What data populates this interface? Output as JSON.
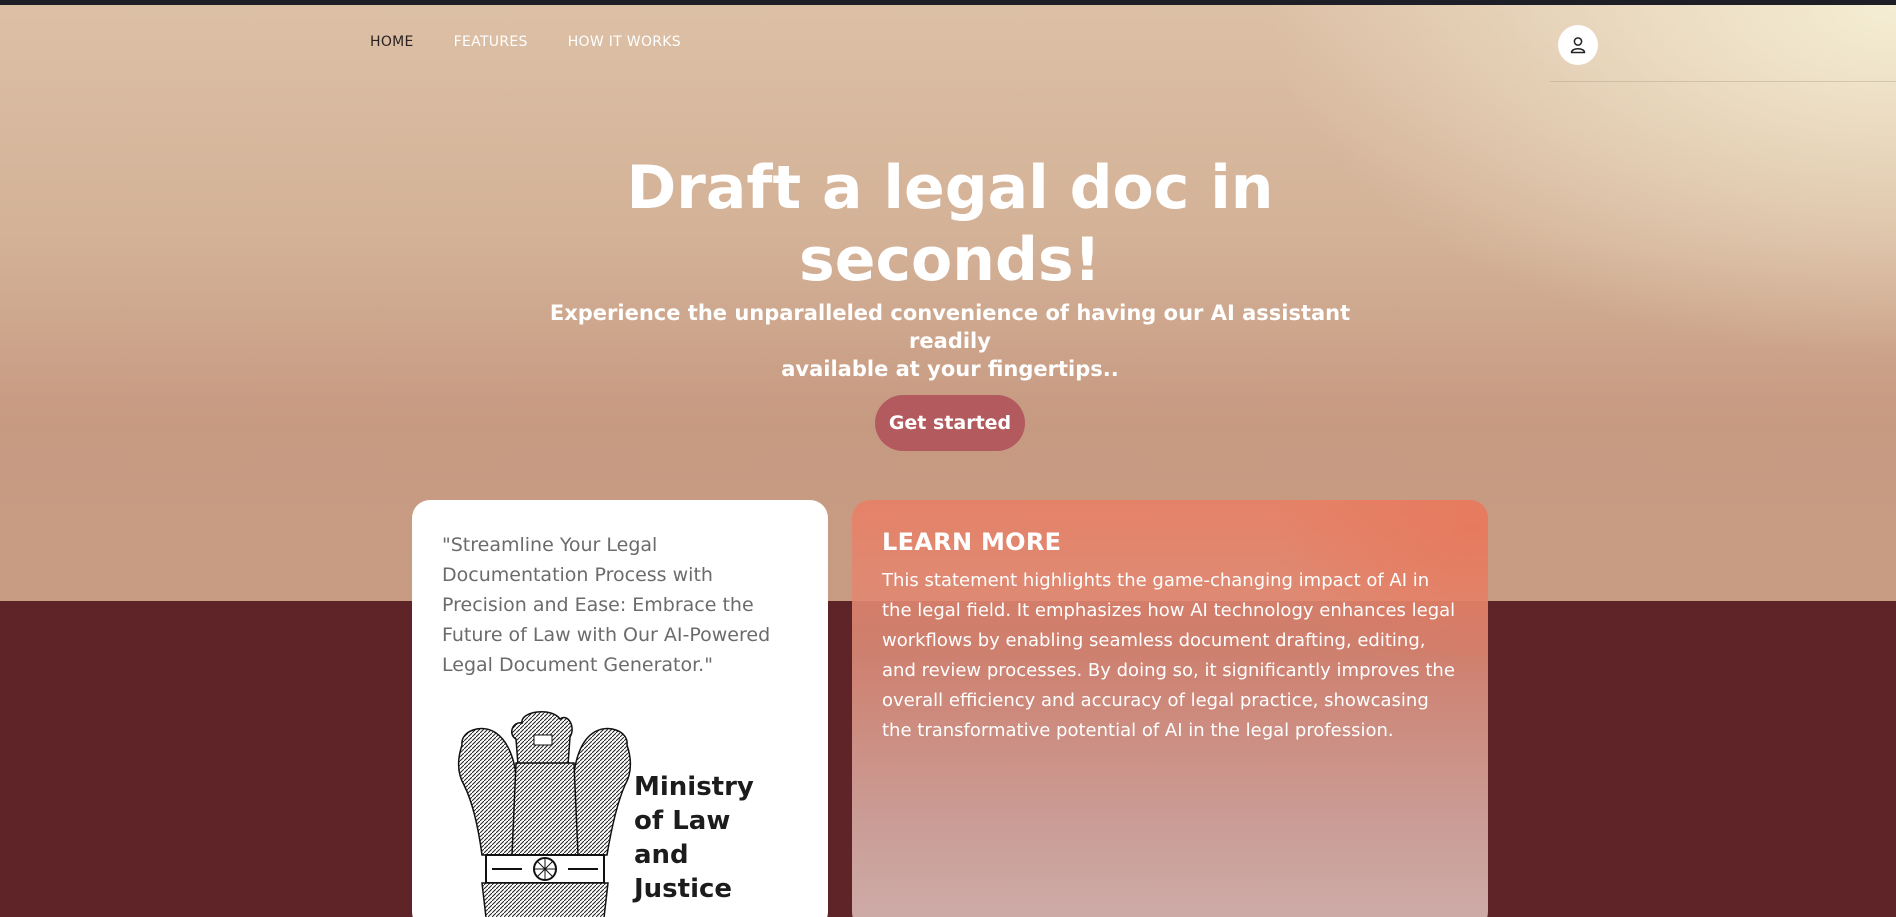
{
  "nav": {
    "items": [
      {
        "label": "HOME",
        "active": true
      },
      {
        "label": "FEATURES",
        "active": false
      },
      {
        "label": "HOW IT WORKS",
        "active": false
      }
    ],
    "profile_icon": "user-icon"
  },
  "hero": {
    "title_line1": "Draft a legal doc in",
    "title_line2": "seconds!",
    "subtitle_line1": "Experience the unparalleled convenience of having our AI assistant readily",
    "subtitle_line2": "available at your fingertips..",
    "cta_label": "Get started"
  },
  "quote_card": {
    "quote": "\"Streamline Your Legal Documentation Process with Precision and Ease: Embrace the Future of Law with Our AI-Powered Legal Document Generator.\"",
    "logo_text": [
      "Ministry",
      "of Law",
      "and",
      "Justice"
    ],
    "emblem_icon": "national-emblem"
  },
  "learn_more": {
    "title": "LEARN MORE",
    "body": "This statement highlights the game-changing impact of AI in the legal field. It emphasizes how AI technology enhances legal workflows by enabling seamless document drafting, editing, and review processes. By doing so, it significantly improves the overall efficiency and accuracy of legal practice, showcasing the transformative potential of AI in the legal profession."
  },
  "colors": {
    "cta_bg": "#b25a5e",
    "lower_bg": "#5e2428",
    "learn_card": "#e78066"
  }
}
